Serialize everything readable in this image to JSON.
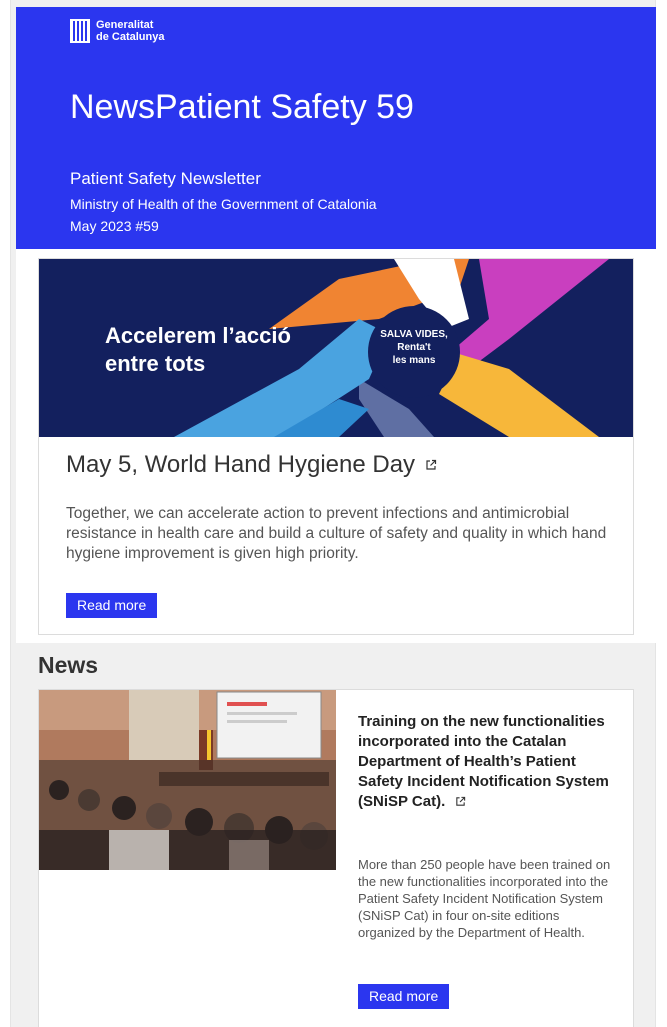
{
  "header": {
    "logo_line1": "Generalitat",
    "logo_line2": "de Catalunya",
    "title": "NewsPatient Safety 59",
    "subtitle": "Patient Safety Newsletter",
    "ministry": "Ministry of Health of the Government of Catalonia",
    "issue": "May 2023 #59",
    "bg_color": "#2b36ef"
  },
  "feature": {
    "banner_line1": "Accelerem l’acció",
    "banner_line2": "entre tots",
    "banner_badge1": "SALVA VIDES,",
    "banner_badge2": "Renta't",
    "banner_badge3": "les mans",
    "heading": "May 5, World Hand Hygiene Day",
    "body": "Together, we can accelerate action to prevent infections and antimicrobial resistance in health care and build a culture of safety and quality in which hand hygiene improvement is given high priority.",
    "button": "Read more",
    "link_icon": "external-link-icon"
  },
  "news": {
    "section_title": "News",
    "items": [
      {
        "heading": "Training on the new functionalities incorporated into the Catalan Department of Health’s Patient Safety Incident Notification System (SNiSP Cat).",
        "body": "More than 250 people have been trained on the new functionalities incorporated into the Patient Safety Incident Notification System (SNiSP Cat) in four on-site editions organized by the Department of Health.",
        "button": "Read more",
        "link_icon": "external-link-icon"
      }
    ]
  },
  "colors": {
    "accent": "#2b36ef",
    "banner_bg": "#13205e"
  }
}
